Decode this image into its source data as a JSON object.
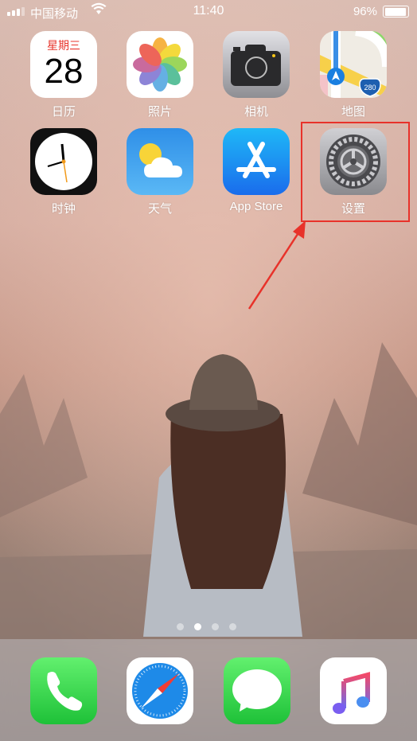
{
  "status_bar": {
    "carrier": "中国移动",
    "time": "11:40",
    "battery_percent": "96%",
    "battery_level": 0.96
  },
  "home": {
    "apps": [
      {
        "name": "calendar",
        "label": "日历",
        "weekday": "星期三",
        "day": "28"
      },
      {
        "name": "photos",
        "label": "照片"
      },
      {
        "name": "camera",
        "label": "相机"
      },
      {
        "name": "maps",
        "label": "地图",
        "shield": "280"
      },
      {
        "name": "clock",
        "label": "时钟"
      },
      {
        "name": "weather",
        "label": "天气"
      },
      {
        "name": "app-store",
        "label": "App Store"
      },
      {
        "name": "settings",
        "label": "设置"
      }
    ]
  },
  "highlight": {
    "target": "settings",
    "color": "#e8322a"
  },
  "page_indicator": {
    "pages": 4,
    "current": 2
  },
  "dock": {
    "apps": [
      "phone",
      "safari",
      "messages",
      "music"
    ]
  }
}
